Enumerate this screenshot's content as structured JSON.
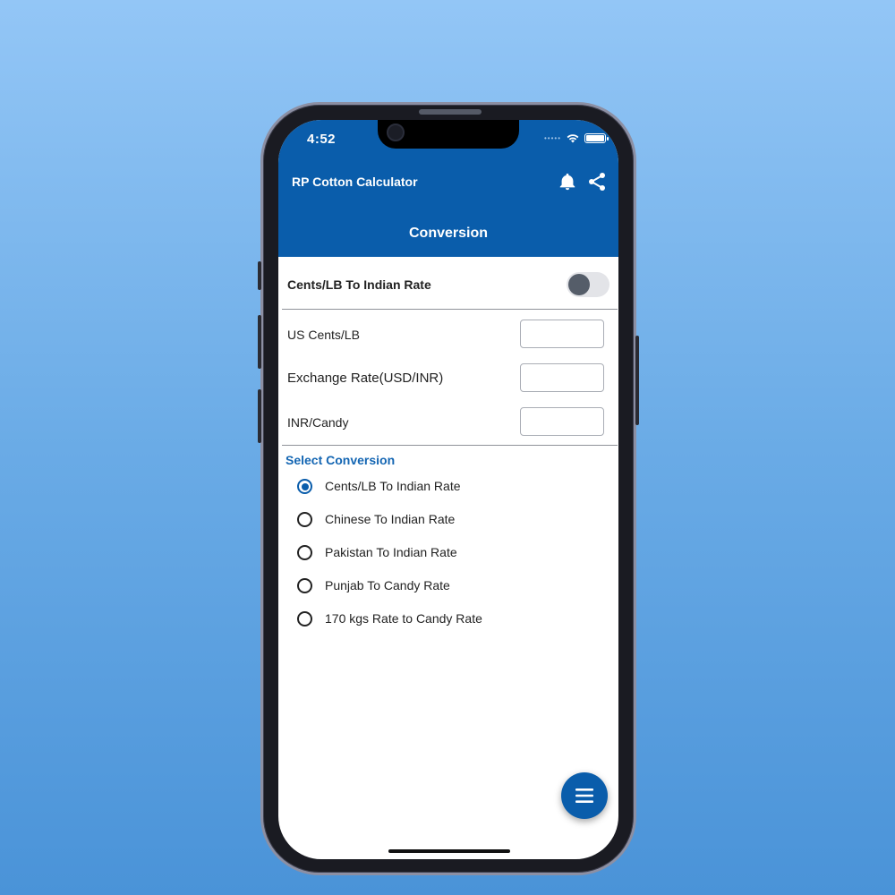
{
  "status_bar": {
    "time": "4:52",
    "signal": "•••••"
  },
  "header": {
    "app_title": "RP Cotton Calculator",
    "page_title": "Conversion",
    "icons": [
      "bell-icon",
      "share-icon"
    ]
  },
  "toggle": {
    "label": "Cents/LB To Indian Rate",
    "on": false
  },
  "fields": [
    {
      "label": "US Cents/LB",
      "value": ""
    },
    {
      "label": "Exchange Rate(USD/INR)",
      "value": ""
    },
    {
      "label": "INR/Candy",
      "value": ""
    }
  ],
  "conversion": {
    "title": "Select Conversion",
    "options": [
      {
        "label": "Cents/LB To Indian Rate",
        "selected": true
      },
      {
        "label": "Chinese To Indian Rate",
        "selected": false
      },
      {
        "label": "Pakistan To Indian Rate",
        "selected": false
      },
      {
        "label": "Punjab To Candy Rate",
        "selected": false
      },
      {
        "label": "170 kgs Rate to Candy Rate",
        "selected": false
      }
    ]
  },
  "fab": {
    "icon": "menu-icon"
  },
  "colors": {
    "primary": "#0a5dab",
    "accent_text": "#1466b3",
    "background_top": "#93c6f6",
    "background_bottom": "#4a93d8"
  }
}
